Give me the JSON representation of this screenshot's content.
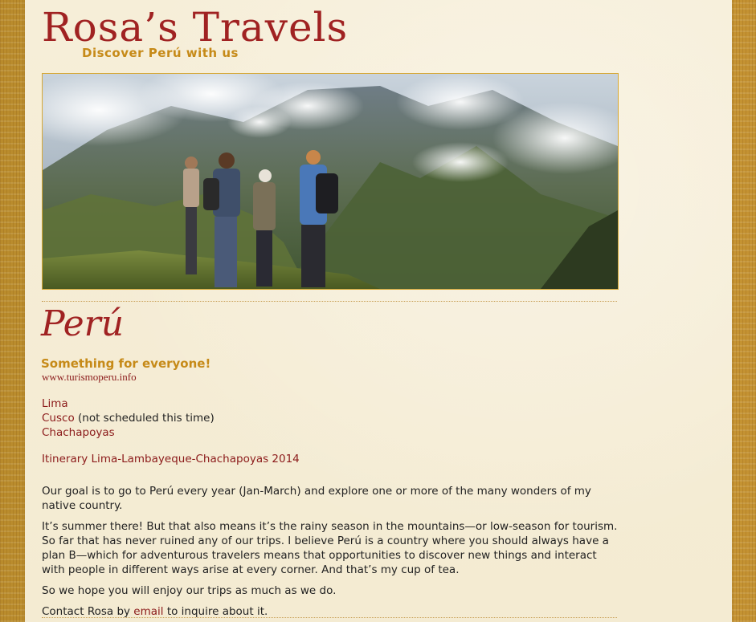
{
  "header": {
    "title": "Rosa’s Travels",
    "tagline": "Discover Perú with us"
  },
  "page": {
    "heading": "Perú",
    "subheading": "Something for everyone!",
    "source_link": "www.turismoperu.info"
  },
  "destinations": [
    {
      "label": "Lima",
      "note": ""
    },
    {
      "label": "Cusco",
      "note": " (not scheduled this time)"
    },
    {
      "label": "Chachapoyas",
      "note": ""
    }
  ],
  "itinerary_link": "Itinerary Lima-Lambayeque-Chachapoyas 2014",
  "paragraphs": {
    "p1": "Our goal is to go to Perú every year (Jan-March) and explore one or more of the many wonders of my native country.",
    "p2": "It’s summer there! But that also means it’s the rainy season in the mountains—or low-season for tourism. So far that has never ruined any of our trips. I believe Perú is a country where you should always have a plan B—which for adventurous travelers means that opportunities to discover new things and interact with people in different ways arise at every corner. And that’s my cup of tea.",
    "p3": "So we hope you will enjoy our trips as much as we do.",
    "p4_before": "Contact Rosa by ",
    "p4_link": "email",
    "p4_after": " to inquire about it."
  },
  "colors": {
    "accent_red": "#a02222",
    "accent_gold": "#c68a18",
    "link": "#8b1a1a",
    "page_bg": "#f6eed8"
  }
}
